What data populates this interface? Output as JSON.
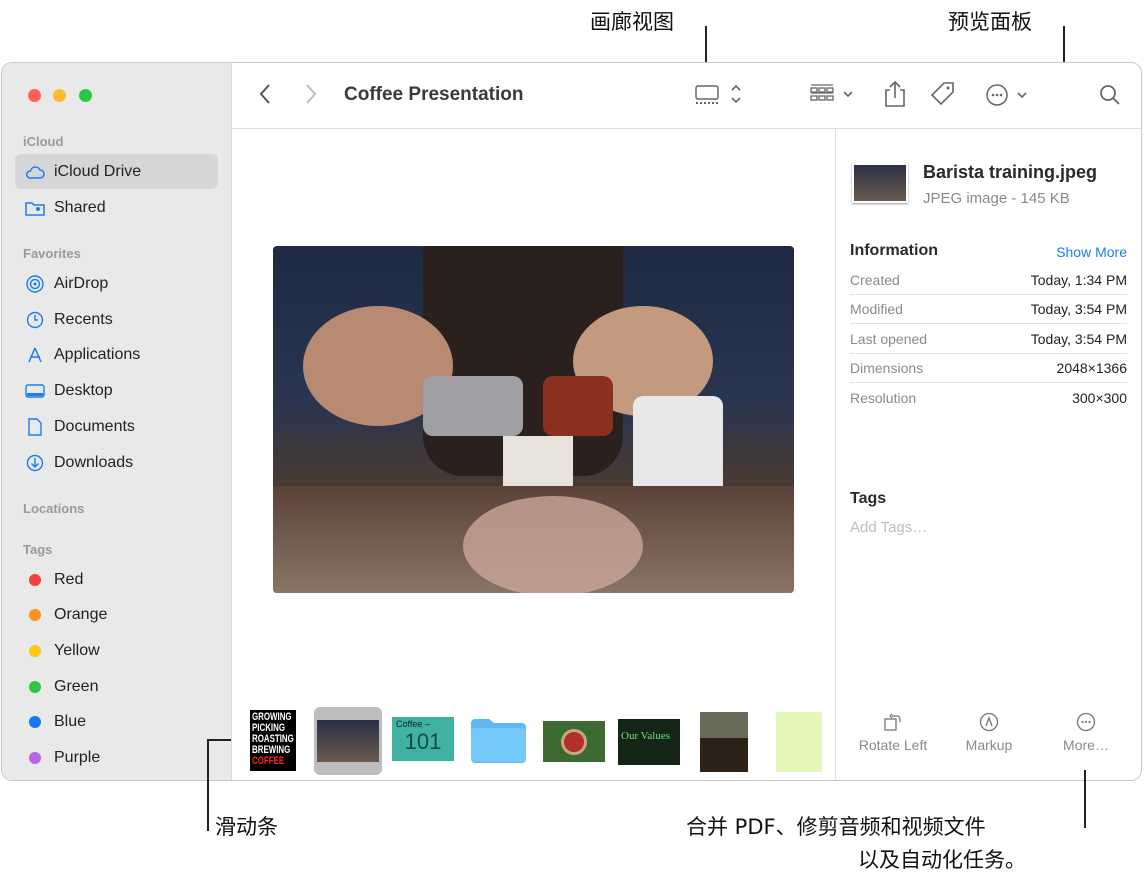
{
  "callouts": {
    "gallery_view": "画廊视图",
    "preview_pane": "预览面板",
    "scrubber": "滑动条",
    "quick_actions_line1": "合并 PDF、修剪音频和视频文件",
    "quick_actions_line2": "以及自动化任务。"
  },
  "toolbar": {
    "title": "Coffee Presentation"
  },
  "sidebar": {
    "icloud_header": "iCloud",
    "icloud": [
      {
        "label": "iCloud Drive",
        "icon": "cloud-icon",
        "selected": true
      },
      {
        "label": "Shared",
        "icon": "shared-folder-icon"
      }
    ],
    "favorites_header": "Favorites",
    "favorites": [
      {
        "label": "AirDrop",
        "icon": "airdrop-icon"
      },
      {
        "label": "Recents",
        "icon": "clock-icon"
      },
      {
        "label": "Applications",
        "icon": "applications-icon"
      },
      {
        "label": "Desktop",
        "icon": "desktop-icon"
      },
      {
        "label": "Documents",
        "icon": "document-icon"
      },
      {
        "label": "Downloads",
        "icon": "download-icon"
      }
    ],
    "locations_header": "Locations",
    "tags_header": "Tags",
    "tags": [
      {
        "label": "Red",
        "color": "#f5413b"
      },
      {
        "label": "Orange",
        "color": "#f7931e"
      },
      {
        "label": "Yellow",
        "color": "#fdc90a"
      },
      {
        "label": "Green",
        "color": "#2fc642"
      },
      {
        "label": "Blue",
        "color": "#1976f5"
      },
      {
        "label": "Purple",
        "color": "#b966e0"
      }
    ]
  },
  "preview": {
    "file_name": "Barista training.jpeg",
    "file_kind": "JPEG image - 145 KB",
    "info_header": "Information",
    "show_more": "Show More",
    "info": [
      {
        "k": "Created",
        "v": "Today, 1:34 PM"
      },
      {
        "k": "Modified",
        "v": "Today, 3:54 PM"
      },
      {
        "k": "Last opened",
        "v": "Today, 3:54 PM"
      },
      {
        "k": "Dimensions",
        "v": "2048×1366"
      },
      {
        "k": "Resolution",
        "v": "300×300"
      }
    ],
    "tags_header": "Tags",
    "add_tags": "Add Tags…",
    "actions": [
      {
        "label": "Rotate Left"
      },
      {
        "label": "Markup"
      },
      {
        "label": "More…"
      }
    ]
  },
  "thumbnails": {
    "poster_text": [
      "GROWING",
      "PICKING",
      "ROASTING",
      "BREWING",
      "COFFEE"
    ],
    "coffee101_title": "Coffee –",
    "coffee101_number": "101",
    "values_text": "Our Values"
  }
}
